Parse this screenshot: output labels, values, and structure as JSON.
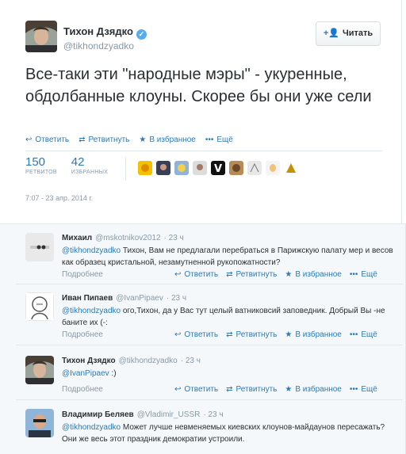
{
  "main": {
    "name": "Тихон Дзядко",
    "handle": "@tikhondzyadko",
    "follow_label": "Читать",
    "text": "Все-таки эти \"народные мэры\" - укуренные, обдолбанные клоуны. Скорее бы они уже сели",
    "actions": {
      "reply": "Ответить",
      "retweet": "Ретвитнуть",
      "favorite": "В избранное",
      "more": "Ещё"
    },
    "stats": {
      "retweets_count": "150",
      "retweets_label": "РЕТВИТОВ",
      "favorites_count": "42",
      "favorites_label": "ИЗБРАННЫХ"
    },
    "timestamp": "7:07 - 23 апр. 2014 г."
  },
  "replies": [
    {
      "name": "Михаил",
      "handle": "@mskotnikov2012",
      "time": "· 23 ч",
      "mention": "@tikhondzyadko",
      "text": " Тихон, Вам не предлагали перебраться в Парижскую палату мер и весов как образец кристальной, незамутненной рукопожатности?",
      "more": "Подробнее"
    },
    {
      "name": "Иван Пипаев",
      "handle": "@IvanPipaev",
      "time": "· 23 ч",
      "mention": "@tikhondzyadko",
      "text": " ого,Тихон, да у Вас тут целый ватниковсий заповедник. Добрый Вы -не баните их (-:",
      "more": "Подробнее"
    },
    {
      "name": "Тихон Дзядко",
      "handle": "@tikhondzyadko",
      "time": "· 23 ч",
      "mention": "@IvanPipaev",
      "text": " :)",
      "more": "Подробнее"
    },
    {
      "name": "Владимир Беляев",
      "handle": "@Vladimir_USSR",
      "time": "· 23 ч",
      "mention": "@tikhondzyadko",
      "text": " Может лучше невменяемых киевских клоунов-майдаунов пересажать? Они же весь этот праздник демократии устроили.",
      "more": ""
    }
  ],
  "reply_actions": {
    "reply": "Ответить",
    "retweet": "Ретвитнуть",
    "favorite": "В избранное",
    "more": "Ещё"
  },
  "colors": {
    "link": "#2a7ab6",
    "muted": "#8899a6",
    "verified": "#55acee",
    "reply_bg": "#f5f8fa"
  }
}
